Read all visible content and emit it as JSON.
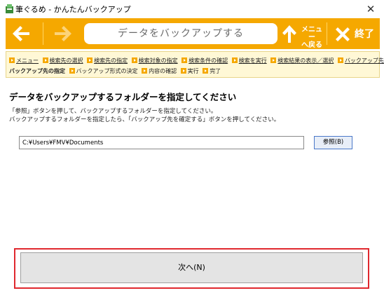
{
  "window": {
    "title": "筆ぐるめ - かんたんバックアップ",
    "close_glyph": "✕"
  },
  "toolbar": {
    "page_title": "データをバックアップする",
    "back_icon": "left-arrow-icon",
    "forward_icon": "right-arrow-icon",
    "menu_back_line1": "メニュー",
    "menu_back_line2": "へ戻る",
    "exit_label": "終了",
    "accent_color": "#f5a800"
  },
  "breadcrumb": {
    "row1": [
      {
        "label": "メニュー",
        "state": "done"
      },
      {
        "label": "検索先の選択",
        "state": "done"
      },
      {
        "label": "検索先の指定",
        "state": "done"
      },
      {
        "label": "検索対象の指定",
        "state": "done"
      },
      {
        "label": "検索条件の確認",
        "state": "done"
      },
      {
        "label": "検索を実行",
        "state": "done"
      },
      {
        "label": "検索結果の表示／選択",
        "state": "done"
      },
      {
        "label": "バックアップ先の選択",
        "state": "done"
      }
    ],
    "row2": [
      {
        "label": "バックアップ先の指定",
        "state": "current"
      },
      {
        "label": "バックアップ形式の決定",
        "state": "future"
      },
      {
        "label": "内容の確認",
        "state": "future"
      },
      {
        "label": "実行",
        "state": "future"
      },
      {
        "label": "完了",
        "state": "future"
      }
    ]
  },
  "main": {
    "heading": "データをバックアップするフォルダーを指定してください",
    "desc_line1": "「参照」ボタンを押して、バックアップするフォルダーを指定してください。",
    "desc_line2": "バックアップするフォルダーを指定したら、「バックアップ先を確定する」ボタンを押してください。",
    "folder_path": "C:¥Users¥FMV¥Documents",
    "browse_label": "参照(B)",
    "next_label": "次へ(N)",
    "highlight_color": "#e0282e"
  }
}
